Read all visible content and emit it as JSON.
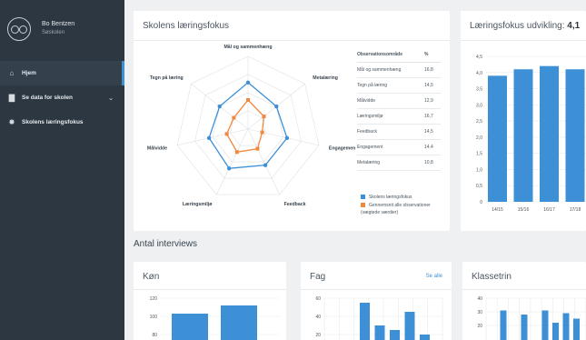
{
  "profile": {
    "name": "Bo Bentzen",
    "school": "Søskolen"
  },
  "nav": [
    {
      "label": "Hjem",
      "icon": "home-icon"
    },
    {
      "label": "Se data for skolen",
      "icon": "bar-chart-icon"
    },
    {
      "label": "Skolens læringsfokus",
      "icon": "compass-icon"
    }
  ],
  "focus_card": {
    "title": "Skolens læringsfokus",
    "table": {
      "headers": [
        "Observationsområde",
        "%"
      ],
      "rows": [
        [
          "Mål og sammenhæng",
          "16,8"
        ],
        [
          "Tegn på læring",
          "14,5"
        ],
        [
          "Målvidde",
          "12,9"
        ],
        [
          "Læringsmiljø",
          "16,7"
        ],
        [
          "Feedback",
          "14,5"
        ],
        [
          "Engagement",
          "14,4"
        ],
        [
          "Metalæring",
          "10,8"
        ]
      ]
    },
    "legend": {
      "series_a": "Skolens læringsfokus",
      "series_b": "Gennemsnit alle observationer",
      "note": "(vægtede værdier)"
    }
  },
  "development_card": {
    "title": "Læringsfokus udvikling:",
    "value": "4,1"
  },
  "section_label": "Antal interviews",
  "gender_card": {
    "title": "Køn"
  },
  "subject_card": {
    "title": "Fag",
    "see_all": "Se alle"
  },
  "grade_card": {
    "title": "Klassetrin"
  },
  "colors": {
    "primary": "#3d8fd6",
    "secondary": "#f0883e",
    "sidebar": "#2c3742"
  },
  "chart_data": [
    {
      "type": "radar",
      "axes": [
        "Mål og sammenhæng",
        "Metalæring",
        "Engagement",
        "Feedback",
        "Læringsmiljø",
        "Målvidde",
        "Tegn på læring"
      ],
      "series": [
        {
          "name": "Skolens læringsfokus",
          "values": [
            0.64,
            0.5,
            0.55,
            0.55,
            0.6,
            0.55,
            0.5
          ]
        },
        {
          "name": "Gennemsnit alle observationer",
          "values": [
            0.4,
            0.28,
            0.2,
            0.3,
            0.35,
            0.3,
            0.25
          ]
        }
      ]
    },
    {
      "type": "bar",
      "categories": [
        "14/15",
        "15/16",
        "16/17",
        "17/18"
      ],
      "values": [
        3.9,
        4.1,
        4.2,
        4.1
      ],
      "ylim": [
        0,
        4.5
      ],
      "yticks": [
        "0",
        "0,5",
        "1,0",
        "1,5",
        "2,0",
        "2,5",
        "3,0",
        "3,5",
        "4,0",
        "4,5"
      ]
    },
    {
      "type": "bar",
      "values": [
        103,
        112
      ],
      "yticks": [
        "80",
        "100",
        "120"
      ]
    },
    {
      "type": "bar",
      "values": [
        2,
        4,
        55,
        30,
        25,
        45,
        20
      ],
      "ylim": [
        0,
        60
      ],
      "yticks": [
        "20",
        "40",
        "60"
      ]
    },
    {
      "type": "bar",
      "values": [
        3,
        31,
        5,
        28,
        2,
        31,
        22,
        29,
        25
      ],
      "ylim": [
        0,
        40
      ],
      "yticks": [
        "20",
        "30",
        "40"
      ]
    }
  ]
}
